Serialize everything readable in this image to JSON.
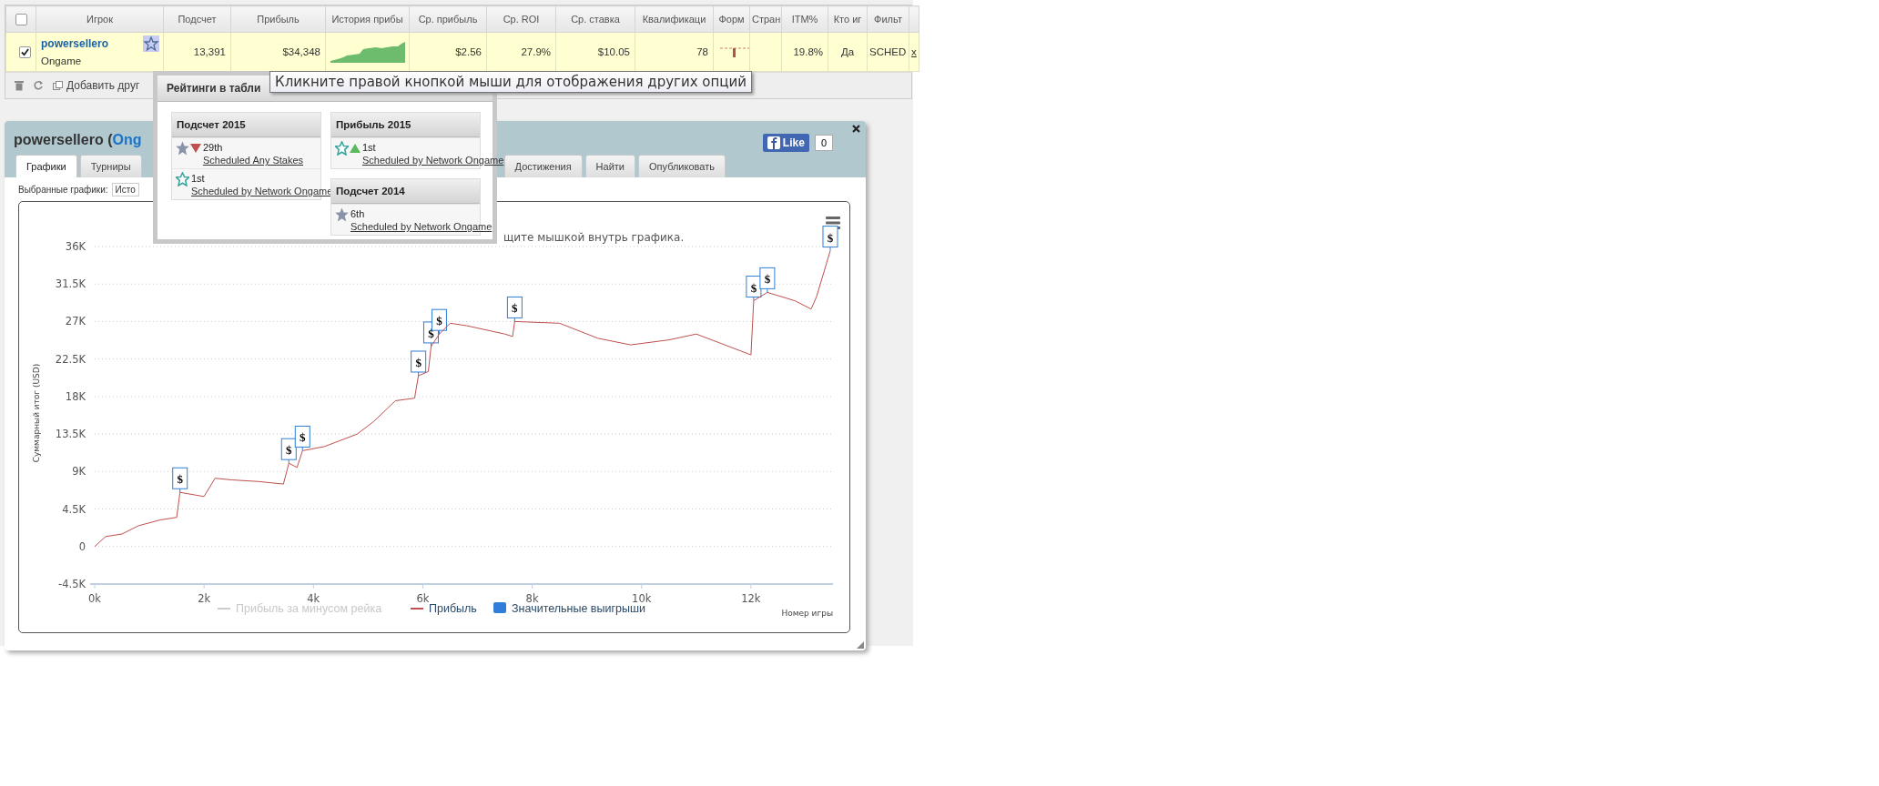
{
  "table": {
    "header_checked": false,
    "columns": [
      "Игрок",
      "Подсчет",
      "Прибыль",
      "История прибы",
      "Ср. прибыль",
      "Ср. ROI",
      "Ср. ставка",
      "Квалификаци",
      "Форм",
      "Стран",
      "ITM%",
      "Кто иг",
      "Фильт"
    ],
    "rows": [
      {
        "checked": true,
        "player": "powersellero",
        "network": "Ongame",
        "count": "13,391",
        "profit": "$34,348",
        "avg_profit": "$2.56",
        "avg_roi": "27.9%",
        "avg_stake": "$10.05",
        "qualification": "78",
        "itm": "19.8%",
        "who": "Да",
        "filter": "SCHED",
        "remove": "x"
      }
    ]
  },
  "toolbar": {
    "add_button": "Добавить друг"
  },
  "tooltip": "Кликните правой кнопкой мыши для отображения других опций",
  "ratings_popup": {
    "title": "Рейтинги в табли",
    "columns": [
      {
        "groups": [
          {
            "title": "Подсчет 2015",
            "entries": [
              {
                "kind": "solid",
                "rose": false,
                "fell": true,
                "rank": "29th",
                "link": "Scheduled Any Stakes"
              },
              {
                "kind": "outline",
                "rose": false,
                "fell": false,
                "rank": "1st",
                "link": "Scheduled by Network Ongame"
              }
            ]
          }
        ]
      },
      {
        "groups": [
          {
            "title": "Прибыль 2015",
            "entries": [
              {
                "kind": "outline",
                "rose": true,
                "fell": false,
                "rank": "1st",
                "link": "Scheduled by Network Ongame"
              }
            ]
          },
          {
            "title": "Подсчет 2014",
            "entries": [
              {
                "kind": "solid",
                "rose": false,
                "fell": false,
                "rank": "6th",
                "link": "Scheduled by Network Ongame"
              }
            ]
          }
        ]
      }
    ]
  },
  "profile": {
    "name": "powersellero (",
    "network_link": "Ong",
    "like_button": "Like",
    "like_count": "0",
    "tabs": [
      {
        "label": "Графики",
        "selected": true
      },
      {
        "label": "Турниры",
        "selected": false
      },
      {
        "label": "Достижения",
        "selected": false
      },
      {
        "label": "Найти",
        "selected": false
      },
      {
        "label": "Опубликовать",
        "selected": false
      }
    ],
    "chart_selector": {
      "label": "Выбранные графики:",
      "value": "Исто"
    },
    "chart_hint": "щите мышкой внутрь графика.",
    "chart_data": {
      "type": "line",
      "xlabel": "Номер игры",
      "ylabel": "Суммарный итог (USD)",
      "grid": true,
      "x": [
        0,
        0.2,
        0.5,
        0.8,
        1.2,
        1.5,
        1.56,
        2.0,
        2.2,
        2.5,
        3.0,
        3.45,
        3.55,
        3.7,
        3.8,
        4.2,
        4.8,
        5.1,
        5.5,
        5.85,
        5.92,
        6.1,
        6.15,
        6.3,
        6.5,
        6.8,
        7.5,
        7.64,
        7.68,
        8.5,
        9.2,
        9.8,
        10.5,
        11.0,
        11.4,
        11.8,
        12.0,
        12.05,
        12.3,
        12.8,
        13.1,
        13.2,
        13.45
      ],
      "series": [
        {
          "name": "Прибыль",
          "color": "#c0504d",
          "values": [
            0,
            1.2,
            1.5,
            2.5,
            3.2,
            3.5,
            6.5,
            6.0,
            8.2,
            8.0,
            7.8,
            7.5,
            10,
            9.5,
            11.5,
            12,
            13.5,
            15,
            17.5,
            17.8,
            20.5,
            21,
            24,
            25.5,
            26.8,
            26.5,
            25.5,
            25.2,
            27.0,
            26.8,
            25.0,
            24.2,
            24.8,
            25.5,
            24.5,
            23.5,
            23.0,
            29.5,
            30.5,
            29.5,
            28.5,
            30,
            35.5
          ]
        }
      ],
      "xlim": [
        0,
        13.5
      ],
      "ylim": [
        -4.5,
        36
      ],
      "xticks": [
        {
          "value": 0,
          "label": "0k"
        },
        {
          "value": 2,
          "label": "2k"
        },
        {
          "value": 4,
          "label": "4k"
        },
        {
          "value": 6,
          "label": "6k"
        },
        {
          "value": 8,
          "label": "8k"
        },
        {
          "value": 10,
          "label": "10k"
        },
        {
          "value": 12,
          "label": "12k"
        }
      ],
      "yticks": [
        {
          "value": -4.5,
          "label": "-4.5K"
        },
        {
          "value": 0,
          "label": "0"
        },
        {
          "value": 4.5,
          "label": "4.5K"
        },
        {
          "value": 9,
          "label": "9K"
        },
        {
          "value": 13.5,
          "label": "13.5K"
        },
        {
          "value": 18,
          "label": "18K"
        },
        {
          "value": 22.5,
          "label": "22.5K"
        },
        {
          "value": 27,
          "label": "27K"
        },
        {
          "value": 31.5,
          "label": "31.5K"
        },
        {
          "value": 36,
          "label": "36K"
        }
      ],
      "annotations": [
        {
          "x": 1.56,
          "y": 6.5,
          "text": "$"
        },
        {
          "x": 3.55,
          "y": 10,
          "text": "$"
        },
        {
          "x": 3.8,
          "y": 11.5,
          "text": "$"
        },
        {
          "x": 5.92,
          "y": 20.5,
          "text": "$"
        },
        {
          "x": 6.15,
          "y": 24,
          "text": "$"
        },
        {
          "x": 6.3,
          "y": 25.5,
          "text": "$"
        },
        {
          "x": 7.68,
          "y": 27.0,
          "text": "$"
        },
        {
          "x": 12.05,
          "y": 29.5,
          "text": "$"
        },
        {
          "x": 12.3,
          "y": 30.5,
          "text": "$"
        },
        {
          "x": 13.45,
          "y": 35.5,
          "text": "$"
        }
      ]
    },
    "legend": [
      {
        "label": "Прибыль за минусом рейка",
        "kind": "line",
        "color": "#cccccc",
        "visible": false
      },
      {
        "kind": "series",
        "visible": true
      },
      {
        "label": "Значительные выигрыши",
        "kind": "square",
        "color": "#2f7ed8",
        "visible": true
      }
    ]
  }
}
